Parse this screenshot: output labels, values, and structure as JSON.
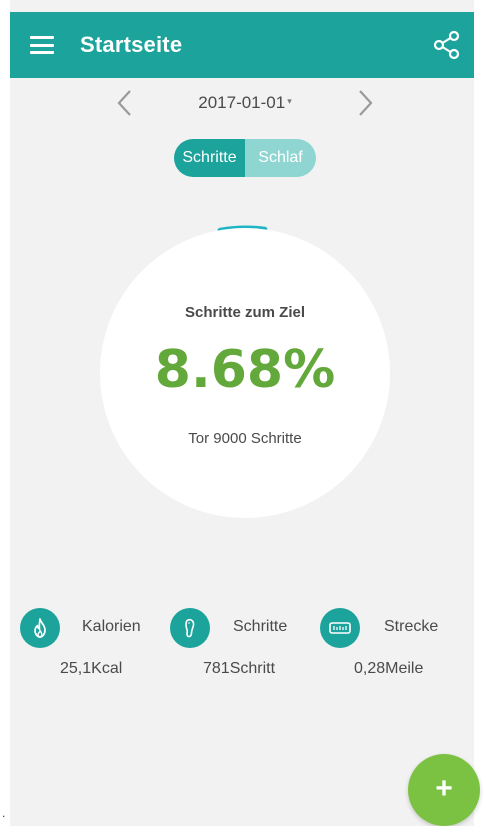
{
  "theme": {
    "brand": "#1ba39c",
    "brand_light": "#8fd6d2",
    "green": "#63a83a",
    "fab": "#7cc242",
    "arc": "#20b5c4"
  },
  "appbar": {
    "menu_icon": "hamburger-menu-icon",
    "title": "Startseite",
    "share_icon": "share-icon"
  },
  "date_nav": {
    "prev_icon": "chevron-left-icon",
    "date": "2017-01-01",
    "caret": "▾",
    "next_icon": "chevron-right-icon"
  },
  "segments": {
    "active": "Schritte",
    "inactive": "Schlaf"
  },
  "progress": {
    "label": "Schritte zum Ziel",
    "value_text": "8.68%",
    "fraction": 0.0868,
    "goal_text": "Tor 9000 Schritte"
  },
  "stats": [
    {
      "icon": "flame-icon",
      "label": "Kalorien",
      "value": "25,1Kcal"
    },
    {
      "icon": "footprint-icon",
      "label": "Schritte",
      "value": "781Schritt"
    },
    {
      "icon": "distance-ruler-icon",
      "label": "Strecke",
      "value": "0,28Meile"
    }
  ],
  "fab": {
    "icon": "plus-icon",
    "label": "+"
  }
}
